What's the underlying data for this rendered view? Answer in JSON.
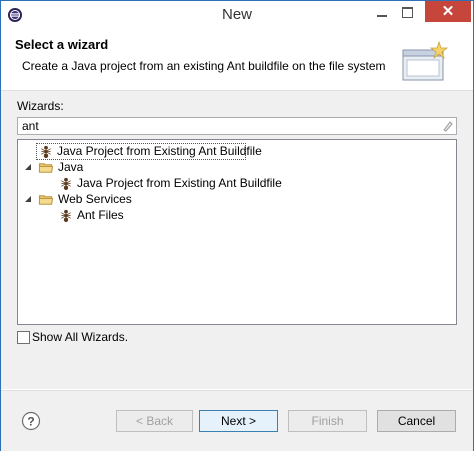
{
  "window": {
    "title": "New",
    "close_glyph": "✕"
  },
  "header": {
    "title": "Select a wizard",
    "description": "Create a Java project from an existing Ant buildfile on the file system"
  },
  "filter": {
    "label": "Wizards:",
    "value": "ant"
  },
  "tree": {
    "items": [
      {
        "label": "Java Project from Existing Ant Buildfile",
        "icon": "ant-icon",
        "selected": true
      },
      {
        "label": "Java",
        "icon": "folder-icon",
        "expanded": true
      },
      {
        "label": "Java Project from Existing Ant Buildfile",
        "icon": "ant-icon"
      },
      {
        "label": "Web Services",
        "icon": "folder-icon",
        "expanded": true
      },
      {
        "label": "Ant Files",
        "icon": "ant-icon"
      }
    ]
  },
  "show_all": {
    "label": "Show All Wizards.",
    "checked": false
  },
  "buttons": {
    "back": "< Back",
    "next": "Next >",
    "finish": "Finish",
    "cancel": "Cancel"
  }
}
